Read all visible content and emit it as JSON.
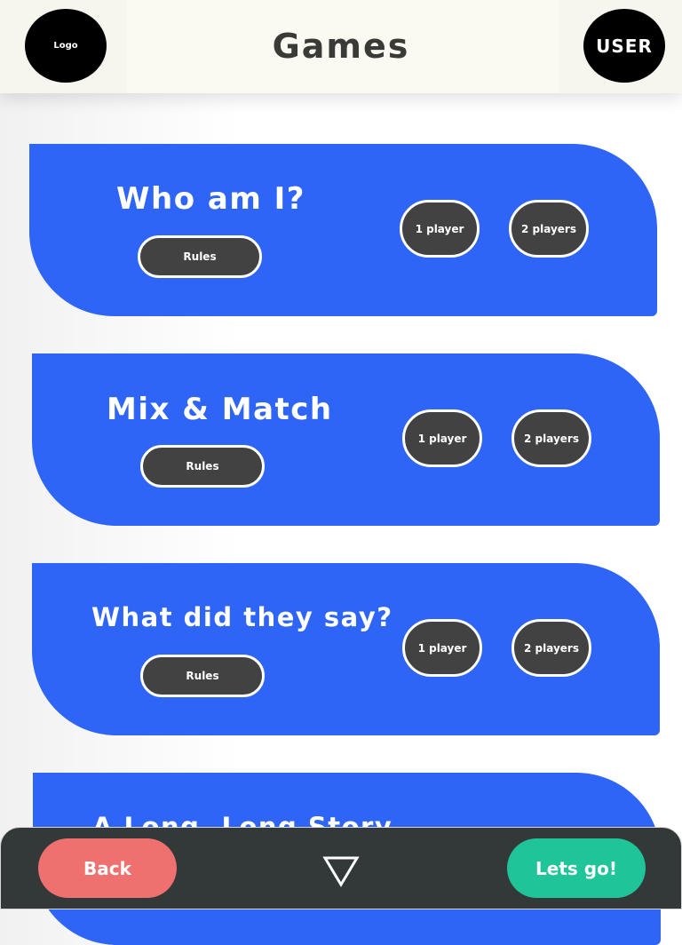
{
  "header": {
    "logo_label": "Logo",
    "title": "Games",
    "user_label": "USER"
  },
  "games": [
    {
      "title": "Who am I?",
      "rules_label": "Rules",
      "one_player_label": "1 player",
      "two_players_label": "2 players"
    },
    {
      "title": "Mix & Match",
      "rules_label": "Rules",
      "one_player_label": "1 player",
      "two_players_label": "2 players"
    },
    {
      "title": "What did they say?",
      "rules_label": "Rules",
      "one_player_label": "1 player",
      "two_players_label": "2 players"
    },
    {
      "title": "A Long, Long Story"
    }
  ],
  "bottom_bar": {
    "back_label": "Back",
    "go_label": "Lets go!",
    "scroll_icon": "triangle-down-icon"
  },
  "colors": {
    "card_blue": "#2f65f7",
    "pill_dark": "#424242",
    "back_red": "#ee706f",
    "go_green": "#1fc499",
    "bar_dark": "#333838",
    "header_bg": "#f6f5ee"
  }
}
